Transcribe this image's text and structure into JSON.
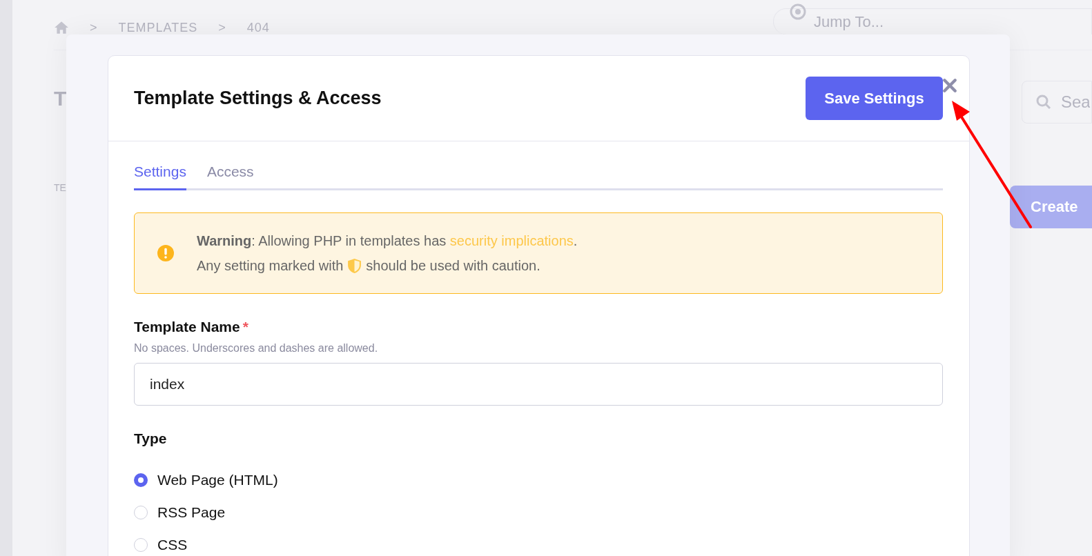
{
  "background_page": {
    "breadcrumb": [
      {
        "kind": "home"
      },
      {
        "kind": "separator",
        "text": ">"
      },
      {
        "kind": "link",
        "text": "TEMPLATES"
      },
      {
        "kind": "separator",
        "text": ">"
      },
      {
        "kind": "link",
        "text": "404"
      }
    ],
    "jump_to": {
      "placeholder": "Jump To..."
    },
    "heading": "T",
    "subheading": "TE",
    "search": {
      "placeholder": "Sea"
    },
    "create_button": "Create"
  },
  "modal": {
    "title": "Template Settings & Access",
    "save_button": "Save Settings",
    "tabs": [
      {
        "label": "Settings",
        "selected": true
      },
      {
        "label": "Access",
        "selected": false
      }
    ],
    "alert": {
      "line1": "**Warning**: Allowing PHP in templates has ",
      "link": "security implications",
      "line1_end": ".",
      "line2_before": "Any setting marked with",
      "line2_after": "should be used with caution."
    },
    "template_name": {
      "label": "Template Name",
      "required_mark": "*",
      "help": "No spaces. Underscores and dashes are allowed.",
      "value": "index"
    },
    "type": {
      "label": "Type",
      "options": [
        {
          "label": "Web Page (HTML)",
          "selected": true
        },
        {
          "label": "RSS Page",
          "selected": false
        },
        {
          "label": "CSS",
          "selected": false
        }
      ]
    }
  }
}
